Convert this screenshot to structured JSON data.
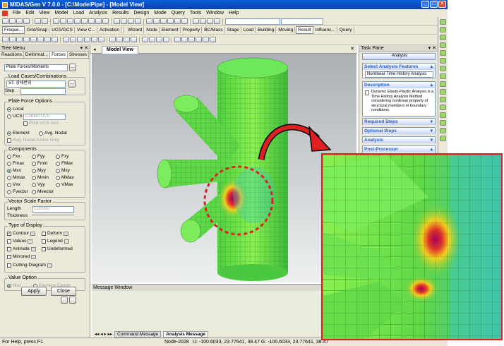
{
  "app": {
    "title": "MIDAS/Gen V 7.0.0 - [C:\\ModelPipe] - [Model View]"
  },
  "menu": [
    "File",
    "Edit",
    "View",
    "Model",
    "Load",
    "Analysis",
    "Results",
    "Design",
    "Mode",
    "Query",
    "Tools",
    "Window",
    "Help"
  ],
  "toolbar": {
    "tabs": [
      "Freque...",
      "Grid/Snap",
      "UCS/GCS",
      "View C...",
      "Activation"
    ],
    "tabs2": [
      "Wizard",
      "Node",
      "Element",
      "Property",
      "BC/Mass",
      "Stage",
      "Load",
      "Building",
      "Moving",
      "Result",
      "Influenc...",
      "Query"
    ]
  },
  "tree": {
    "title": "Tree Menu",
    "tabs": [
      "Reactions",
      "Deformat...",
      "Forces",
      "Stresses"
    ],
    "result_type": "Plate Forces/Moments",
    "lc_label": "Load Cases/Combinations",
    "lc_value": "ST: 강제변위",
    "step_label": "Step",
    "pfo_label": "Plate Force Options",
    "local": "Local",
    "ucs": "UCS",
    "current_ucs": "Current UCS",
    "print_ucs": "Print UCS Axis",
    "element": "Element",
    "avg_nodal": "Avg. Nodal",
    "avg_active": "Avg. Nodal Active Only",
    "components_label": "Components",
    "components": [
      [
        "Fxx",
        "Fyy",
        "Fxy"
      ],
      [
        "Fmax",
        "Fmin",
        "FMax"
      ],
      [
        "Mxx",
        "Myy",
        "Mxy"
      ],
      [
        "Mmax",
        "Mmin",
        "MMax"
      ],
      [
        "Vxx",
        "Vyy",
        "VMax"
      ],
      [
        "Fvector",
        "Mvector",
        ""
      ]
    ],
    "vsf_label": "Vector Scale Factor",
    "length_label": "Length",
    "length_value": "1.00000",
    "thickness_label": "Thickness",
    "tod_label": "Type of Display",
    "contour": "Contour",
    "deform": "Deform",
    "values": "Values",
    "legend": "Legend",
    "animate": "Animate",
    "undeformed": "Undeformed",
    "mirrored": "Mirrored",
    "cutting": "Cutting Diagram",
    "vo_label": "Value Option",
    "max": "Max",
    "elem_center": "Element Center",
    "apply": "Apply",
    "close": "Close"
  },
  "model_view": {
    "tab": "Model View",
    "msg_title": "Message Window",
    "msg_tabs": [
      "Command Message",
      "Analysis Message"
    ]
  },
  "task": {
    "title": "Task Pane",
    "combo": "Analysis",
    "saf": "Select Analysis Features",
    "feature": "Nonlinear Time History Analysis",
    "desc_title": "Description",
    "desc": "Dynamic Elasto-Plastic Analysis is a Time History Analysis Method considering nonlinear property of structural members or boundary conditions.",
    "required": "Required Steps",
    "optional": "Optional Steps",
    "analysis": "Analysis",
    "post": "Post-Processor"
  },
  "status": {
    "help": "For Help, press F1",
    "node": "Node-2028",
    "coords": "U: -100.6033, 23.77641, 38.47  G: -100.6033, 23.77641, 38.47"
  },
  "colors": {
    "accent": "#0a5fd8",
    "highlight": "#e02020",
    "mesh": "#5de04a"
  }
}
